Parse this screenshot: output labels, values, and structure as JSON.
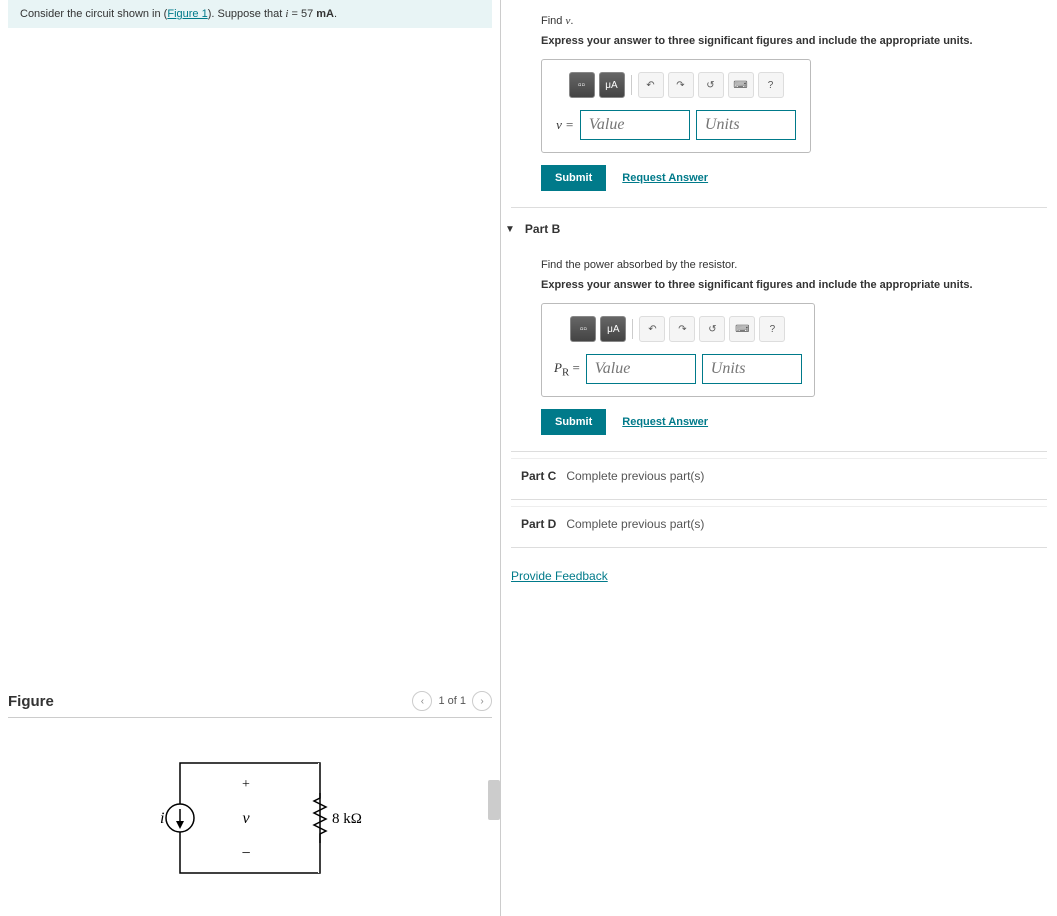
{
  "problem": {
    "prefix": "Consider the circuit shown in (",
    "figureLink": "Figure 1",
    "suffix": "). Suppose that ",
    "varName": "i",
    "eq": " = 57 ",
    "unit": "mA",
    "period": "."
  },
  "figure": {
    "title": "Figure",
    "pageText": "1 of 1",
    "currentLabel": "i",
    "voltageLabel": "v",
    "plus": "+",
    "minus": "−",
    "resistorLabel": "8 kΩ"
  },
  "partA": {
    "question": "Find v.",
    "instruction": "Express your answer to three significant figures and include the appropriate units.",
    "varLabel": "v =",
    "valuePlaceholder": "Value",
    "unitsPlaceholder": "Units",
    "submit": "Submit",
    "request": "Request Answer"
  },
  "partB": {
    "header": "Part B",
    "question": "Find the power absorbed by the resistor.",
    "instruction": "Express your answer to three significant figures and include the appropriate units.",
    "varLabel": "PR =",
    "valuePlaceholder": "Value",
    "unitsPlaceholder": "Units",
    "submit": "Submit",
    "request": "Request Answer"
  },
  "partC": {
    "label": "Part C",
    "text": "Complete previous part(s)"
  },
  "partD": {
    "label": "Part D",
    "text": "Complete previous part(s)"
  },
  "feedback": "Provide Feedback",
  "toolbar": {
    "templates": "▫▫",
    "units": "μA",
    "undo": "↶",
    "redo": "↷",
    "reset": "↺",
    "keyboard": "⌨",
    "help": "?"
  }
}
